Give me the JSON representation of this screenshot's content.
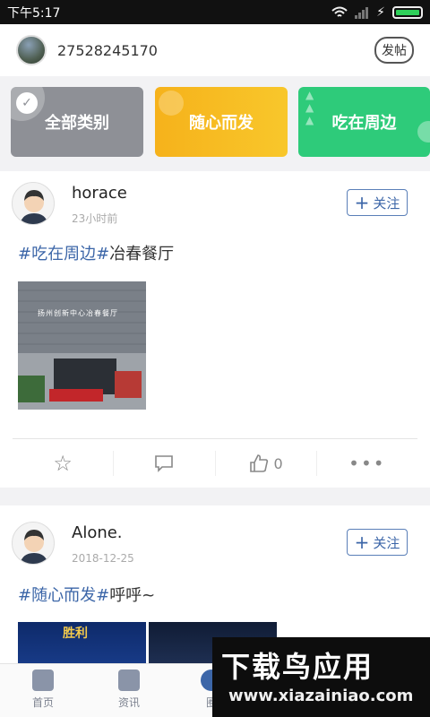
{
  "status_bar": {
    "time": "下午5:17"
  },
  "header": {
    "username": "27528245170",
    "post_label": "发帖"
  },
  "categories": [
    {
      "label": "全部类别",
      "color": "#8e9096",
      "selected": true
    },
    {
      "label": "随心而发",
      "color": "#f6b21b"
    },
    {
      "label": "吃在周边",
      "color": "#2ecb7a"
    }
  ],
  "posts": [
    {
      "author": "horace",
      "time": "23小时前",
      "follow_label": "关注",
      "tag1": "#吃在周边",
      "tag2": "#",
      "text": "冶春餐厅",
      "photo_sign": "扬州创新中心冶春餐厅",
      "likes": "0"
    },
    {
      "author": "Alone.",
      "time": "2018-12-25",
      "follow_label": "关注",
      "tag1": "#随心而发",
      "tag2": "#",
      "text": "呼呼~",
      "game_banner": "胜利"
    }
  ],
  "bottom_nav": [
    {
      "label": "首页",
      "icon": "home-icon"
    },
    {
      "label": "资讯",
      "icon": "news-icon"
    },
    {
      "label": "圈",
      "icon": "circle-icon"
    }
  ],
  "watermark": {
    "title": "下载鸟应用",
    "url": "www.xiazainiao.com"
  }
}
